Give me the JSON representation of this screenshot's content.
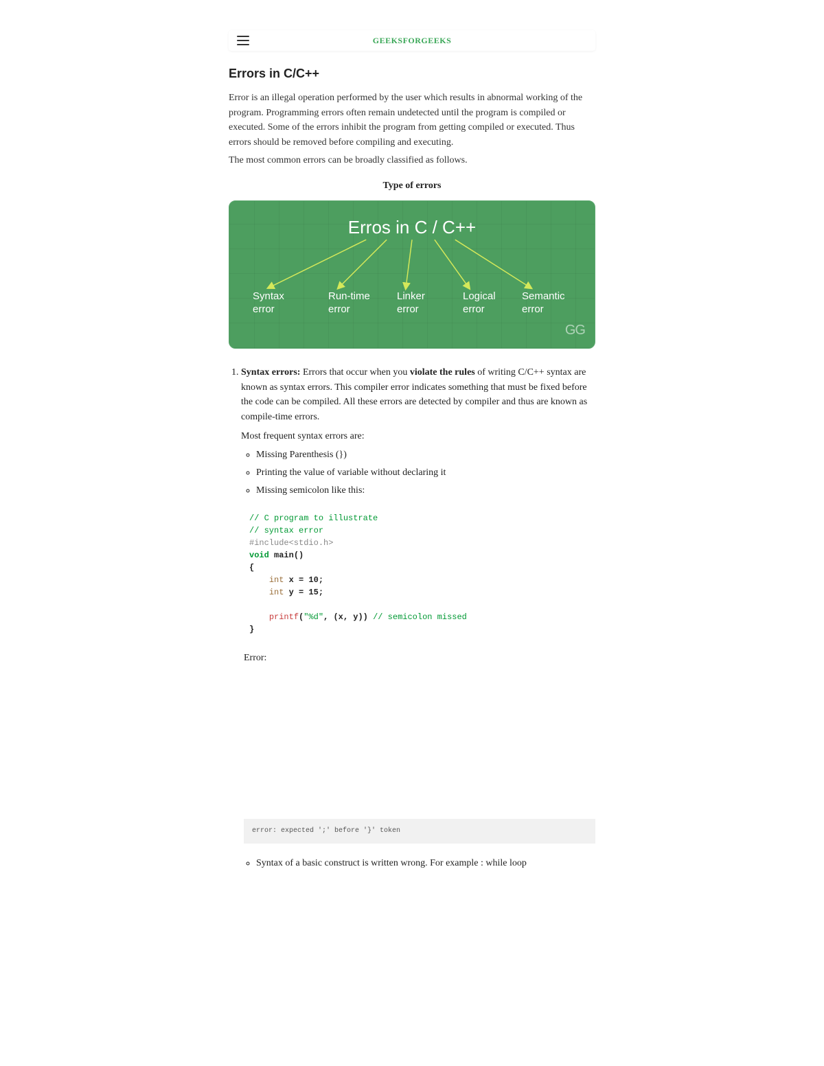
{
  "brand": "GEEKSFORGEEKS",
  "title": "Errors in C/C++",
  "intro1": "Error is an illegal operation performed by the user which results in abnormal working of the program. Programming errors often remain undetected until the program is compiled or executed. Some of the errors inhibit the program from getting compiled or executed. Thus errors should be removed before compiling and executing.",
  "intro2": "The most common errors can be broadly classified as follows.",
  "subhead": "Type of errors",
  "diagram": {
    "title": "Erros in C / C++",
    "labels": [
      {
        "line1": "Syntax",
        "line2": "error"
      },
      {
        "line1": "Run-time",
        "line2": "error"
      },
      {
        "line1": "Linker",
        "line2": "error"
      },
      {
        "line1": "Logical",
        "line2": "error"
      },
      {
        "line1": "Semantic",
        "line2": "error"
      }
    ],
    "logo": "GG"
  },
  "list1": {
    "lead_bold": "Syntax errors:",
    "lead_mid": " Errors that occur when you ",
    "lead_bold2": "violate the rules",
    "lead_tail": " of writing C/C++ syntax are known as syntax errors. This compiler error indicates something that must be fixed before the code can be compiled. All these errors are detected by compiler and thus are known as compile-time errors.",
    "freq": "Most frequent syntax errors are:",
    "sub": [
      "Missing Parenthesis (})",
      "Printing the value of variable without declaring it",
      "Missing semicolon like this:"
    ]
  },
  "code1": {
    "l1": "// C program to illustrate",
    "l2": "// syntax error",
    "l3": "#include<stdio.h>",
    "l4a": "void",
    "l4b": " main()",
    "l5": "{",
    "l6a": "    ",
    "l6b": "int",
    "l6c": " x = 10;",
    "l7a": "    ",
    "l7b": "int",
    "l7c": " y = 15;",
    "blank": "     ",
    "l8a": "    ",
    "l8b": "printf",
    "l8c": "(",
    "l8d": "\"%d\"",
    "l8e": ", (x, y)) ",
    "l8f": "// semicolon missed",
    "l9": "}"
  },
  "errorLabel": "Error:",
  "errorText": "error: expected ';' before '}' token",
  "sub2": "Syntax of a basic construct is written wrong. For example : while loop"
}
